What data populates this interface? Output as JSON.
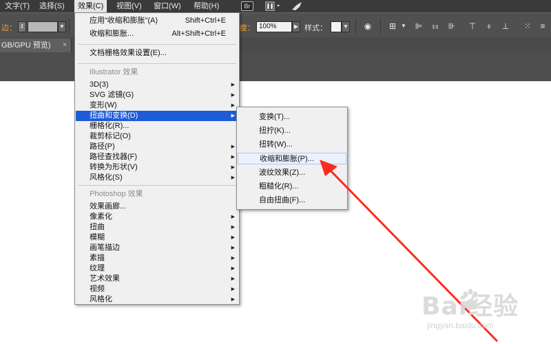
{
  "menubar": {
    "items": [
      "文字(T)",
      "选择(S)",
      "效果(C)",
      "视图(V)",
      "窗口(W)",
      "帮助(H)"
    ],
    "br_badge": "Br"
  },
  "controlbar": {
    "stroke_label": "边：",
    "opacity_label": "度：",
    "opacity_value": "100%",
    "style_label": "样式："
  },
  "tab": {
    "title": "GB/GPU 预览)",
    "close": "×"
  },
  "effect_menu": {
    "items": [
      {
        "label": "应用“收缩和膨胀”(A)",
        "shortcut": "Shift+Ctrl+E"
      },
      {
        "label": "收缩和膨胀...",
        "shortcut": "Alt+Shift+Ctrl+E"
      },
      {
        "label": "文档栅格效果设置(E)..."
      },
      {
        "label": "Illustrator 效果",
        "section": true
      },
      {
        "label": "3D(3)",
        "submenu": true
      },
      {
        "label": "SVG 滤镜(G)",
        "submenu": true
      },
      {
        "label": "变形(W)",
        "submenu": true
      },
      {
        "label": "扭曲和变换(D)",
        "submenu": true,
        "highlighted": true
      },
      {
        "label": "栅格化(R)..."
      },
      {
        "label": "裁剪标记(O)"
      },
      {
        "label": "路径(P)",
        "submenu": true
      },
      {
        "label": "路径查找器(F)",
        "submenu": true
      },
      {
        "label": "转换为形状(V)",
        "submenu": true
      },
      {
        "label": "风格化(S)",
        "submenu": true
      },
      {
        "label": "Photoshop 效果",
        "section": true
      },
      {
        "label": "效果画廊..."
      },
      {
        "label": "像素化",
        "submenu": true
      },
      {
        "label": "扭曲",
        "submenu": true
      },
      {
        "label": "模糊",
        "submenu": true
      },
      {
        "label": "画笔描边",
        "submenu": true
      },
      {
        "label": "素描",
        "submenu": true
      },
      {
        "label": "纹理",
        "submenu": true
      },
      {
        "label": "艺术效果",
        "submenu": true
      },
      {
        "label": "视频",
        "submenu": true
      },
      {
        "label": "风格化",
        "submenu": true
      }
    ]
  },
  "distort_submenu": {
    "items": [
      {
        "label": "变换(T)..."
      },
      {
        "label": "扭拧(K)..."
      },
      {
        "label": "扭转(W)..."
      },
      {
        "label": "收缩和膨胀(P)...",
        "hovered": true
      },
      {
        "label": "波纹效果(Z)..."
      },
      {
        "label": "粗糙化(R)..."
      },
      {
        "label": "自由扭曲(F)..."
      }
    ]
  },
  "watermark": {
    "brand": "Bai经验",
    "url": "jingyan.baidu.com"
  },
  "colors": {
    "highlight": "#1e5bd6",
    "arrow": "#ff2a1a",
    "menubar": "#3a3a3a"
  }
}
